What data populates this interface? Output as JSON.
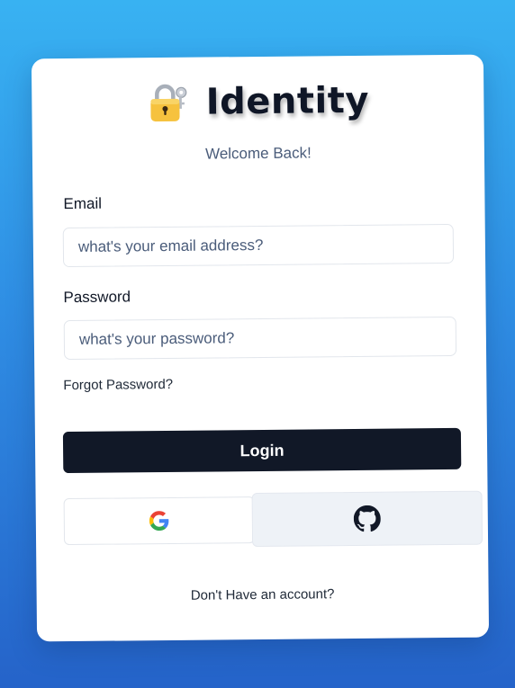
{
  "brand": {
    "icon": "lock-with-key-icon",
    "title": "Identity"
  },
  "subtitle": "Welcome Back!",
  "email": {
    "label": "Email",
    "placeholder": "what's your email address?",
    "value": ""
  },
  "password": {
    "label": "Password",
    "placeholder": "what's your password?",
    "value": ""
  },
  "forgot_password": "Forgot Password?",
  "login_button": "Login",
  "social": {
    "google_icon": "google-icon",
    "github_icon": "github-icon"
  },
  "signup_link": "Don't Have an account?",
  "colors": {
    "background_top": "#38b2f2",
    "background_bottom": "#2563c9",
    "primary_button": "#111827",
    "subtitle_text": "#4a5c7a"
  }
}
